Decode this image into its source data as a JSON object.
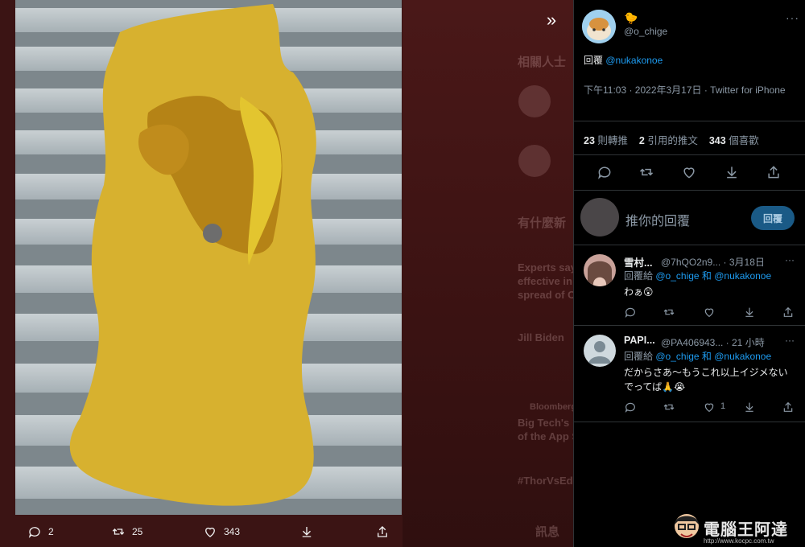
{
  "background": {
    "related_title": "相關人士",
    "trending_title": "有什麼新",
    "trend_headline_1": "Experts say",
    "trend_headline_2": "effective in",
    "trend_headline_3": "spread of C",
    "trend_person": "Jill Biden",
    "trend_source": "Bloomberg",
    "trend_headline_4": "Big Tech's",
    "trend_headline_5": "of the App S",
    "trend_hashtag": "#ThorVsEd",
    "messages_label": "訊息"
  },
  "photo_actions": {
    "reply_count": "2",
    "retweet_count": "25",
    "like_count": "343"
  },
  "tweet": {
    "author_name": "",
    "author_name_emoji": "🐤",
    "author_handle": "@o_chige",
    "reply_label": "回覆",
    "reply_target": "@nukakonoe",
    "meta_text": "下午11:03 · 2022年3月17日 · Twitter for iPhone",
    "retweets_num": "23",
    "retweets_label": "則轉推",
    "quotes_num": "2",
    "quotes_label": "引用的推文",
    "likes_num": "343",
    "likes_label": "個喜歡"
  },
  "compose": {
    "placeholder": "推你的回覆",
    "button": "回覆"
  },
  "replies": [
    {
      "name": "雪村...",
      "handle_date": "@7hQO2n9... · 3月18日",
      "reply_prefix": "回覆給",
      "reply_users": "@o_chige 和 @nukakonoe",
      "text": "わぁ😲",
      "like_count": ""
    },
    {
      "name": "PAPI...",
      "handle_date": "@PA406943... · 21 小時",
      "reply_prefix": "回覆給",
      "reply_users": "@o_chige 和 @nukakonoe",
      "text": "だからさあ〜もうこれ以上イジメないでってば🙏😭",
      "like_count": "1"
    }
  ],
  "watermark": {
    "text": "電腦王阿達",
    "url": "http://www.kocpc.com.tw"
  },
  "colors": {
    "accent": "#1d9bf0",
    "overlay": "#3b1414",
    "panel_bg": "#000000"
  },
  "icons": [
    "reply-icon",
    "retweet-icon",
    "like-icon",
    "download-icon",
    "share-icon",
    "more-icon",
    "collapse-icon"
  ]
}
